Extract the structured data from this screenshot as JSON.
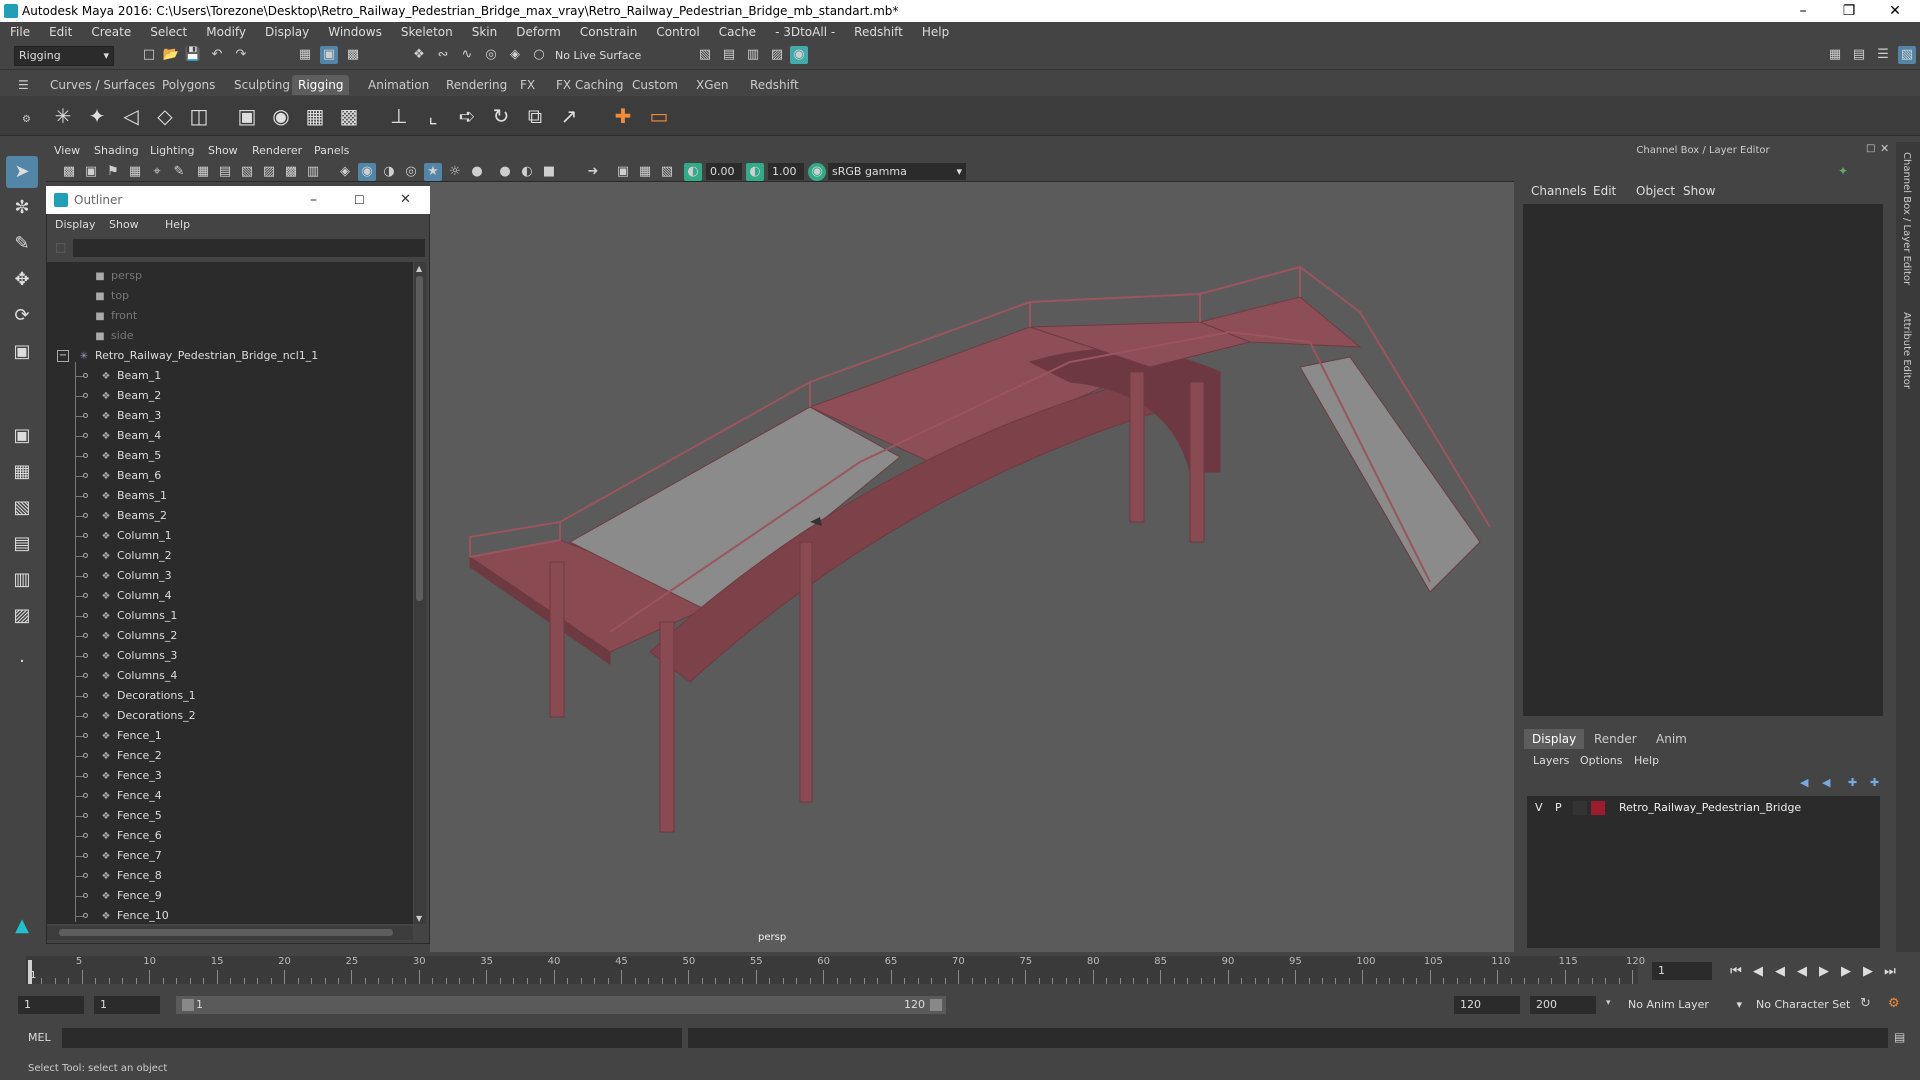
{
  "window": {
    "title": "Autodesk Maya 2016: C:\\Users\\Torezone\\Desktop\\Retro_Railway_Pedestrian_Bridge_max_vray\\Retro_Railway_Pedestrian_Bridge_mb_standart.mb*",
    "minimize_icon": "minimize-icon",
    "maximize_icon": "restore-icon",
    "close_icon": "close-icon"
  },
  "menu": [
    "File",
    "Edit",
    "Create",
    "Select",
    "Modify",
    "Display",
    "Windows",
    "Skeleton",
    "Skin",
    "Deform",
    "Constrain",
    "Control",
    "Cache",
    "- 3DtoAll -",
    "Redshift",
    "Help"
  ],
  "status_line": {
    "menu_set": "Rigging",
    "live_surface": "No Live Surface"
  },
  "shelf_tabs": [
    {
      "label": "Curves / Surfaces",
      "active": false
    },
    {
      "label": "Polygons",
      "active": false
    },
    {
      "label": "Sculpting",
      "active": false
    },
    {
      "label": "Rigging",
      "active": true
    },
    {
      "label": "Animation",
      "active": false
    },
    {
      "label": "Rendering",
      "active": false
    },
    {
      "label": "FX",
      "active": false
    },
    {
      "label": "FX Caching",
      "active": false
    },
    {
      "label": "Custom",
      "active": false
    },
    {
      "label": "XGen",
      "active": false
    },
    {
      "label": "Redshift",
      "active": false
    }
  ],
  "viewport": {
    "menu": [
      "View",
      "Shading",
      "Lighting",
      "Show",
      "Renderer",
      "Panels"
    ],
    "exposure": "0.00",
    "gamma": "1.00",
    "color_space": "sRGB gamma",
    "camera_label": "persp"
  },
  "outliner": {
    "title": "Outliner",
    "menu": [
      "Display",
      "Show",
      "Help"
    ],
    "cameras": [
      "persp",
      "top",
      "front",
      "side"
    ],
    "root": "Retro_Railway_Pedestrian_Bridge_ncl1_1",
    "children": [
      "Beam_1",
      "Beam_2",
      "Beam_3",
      "Beam_4",
      "Beam_5",
      "Beam_6",
      "Beams_1",
      "Beams_2",
      "Column_1",
      "Column_2",
      "Column_3",
      "Column_4",
      "Columns_1",
      "Columns_2",
      "Columns_3",
      "Columns_4",
      "Decorations_1",
      "Decorations_2",
      "Fence_1",
      "Fence_2",
      "Fence_3",
      "Fence_4",
      "Fence_5",
      "Fence_6",
      "Fence_7",
      "Fence_8",
      "Fence_9",
      "Fence_10"
    ]
  },
  "channel_box": {
    "title": "Channel Box / Layer Editor",
    "menu": [
      "Channels",
      "Edit",
      "Object",
      "Show"
    ],
    "layer_tabs": [
      {
        "label": "Display",
        "active": true
      },
      {
        "label": "Render",
        "active": false
      },
      {
        "label": "Anim",
        "active": false
      }
    ],
    "layer_menu": [
      "Layers",
      "Options",
      "Help"
    ],
    "layers": [
      {
        "v": "V",
        "p": "P",
        "color": "#9b1b30",
        "name": "Retro_Railway_Pedestrian_Bridge"
      }
    ],
    "side_tabs": [
      "Channel Box / Layer Editor",
      "Attribute Editor"
    ]
  },
  "timeline": {
    "ticks": [
      1,
      5,
      10,
      15,
      20,
      25,
      30,
      35,
      40,
      45,
      50,
      55,
      60,
      65,
      70,
      75,
      80,
      85,
      90,
      95,
      100,
      105,
      110,
      115,
      120
    ],
    "current_frame": "1"
  },
  "range": {
    "start": "1",
    "playback_start": "1",
    "slider_start": "1",
    "slider_end": "120",
    "playback_end": "120",
    "end": "200",
    "anim_layer": "No Anim Layer",
    "character_set": "No Character Set"
  },
  "command_line": {
    "label": "MEL"
  },
  "help_line": "Select Tool: select an object",
  "bridge_color": "#8a4a52"
}
